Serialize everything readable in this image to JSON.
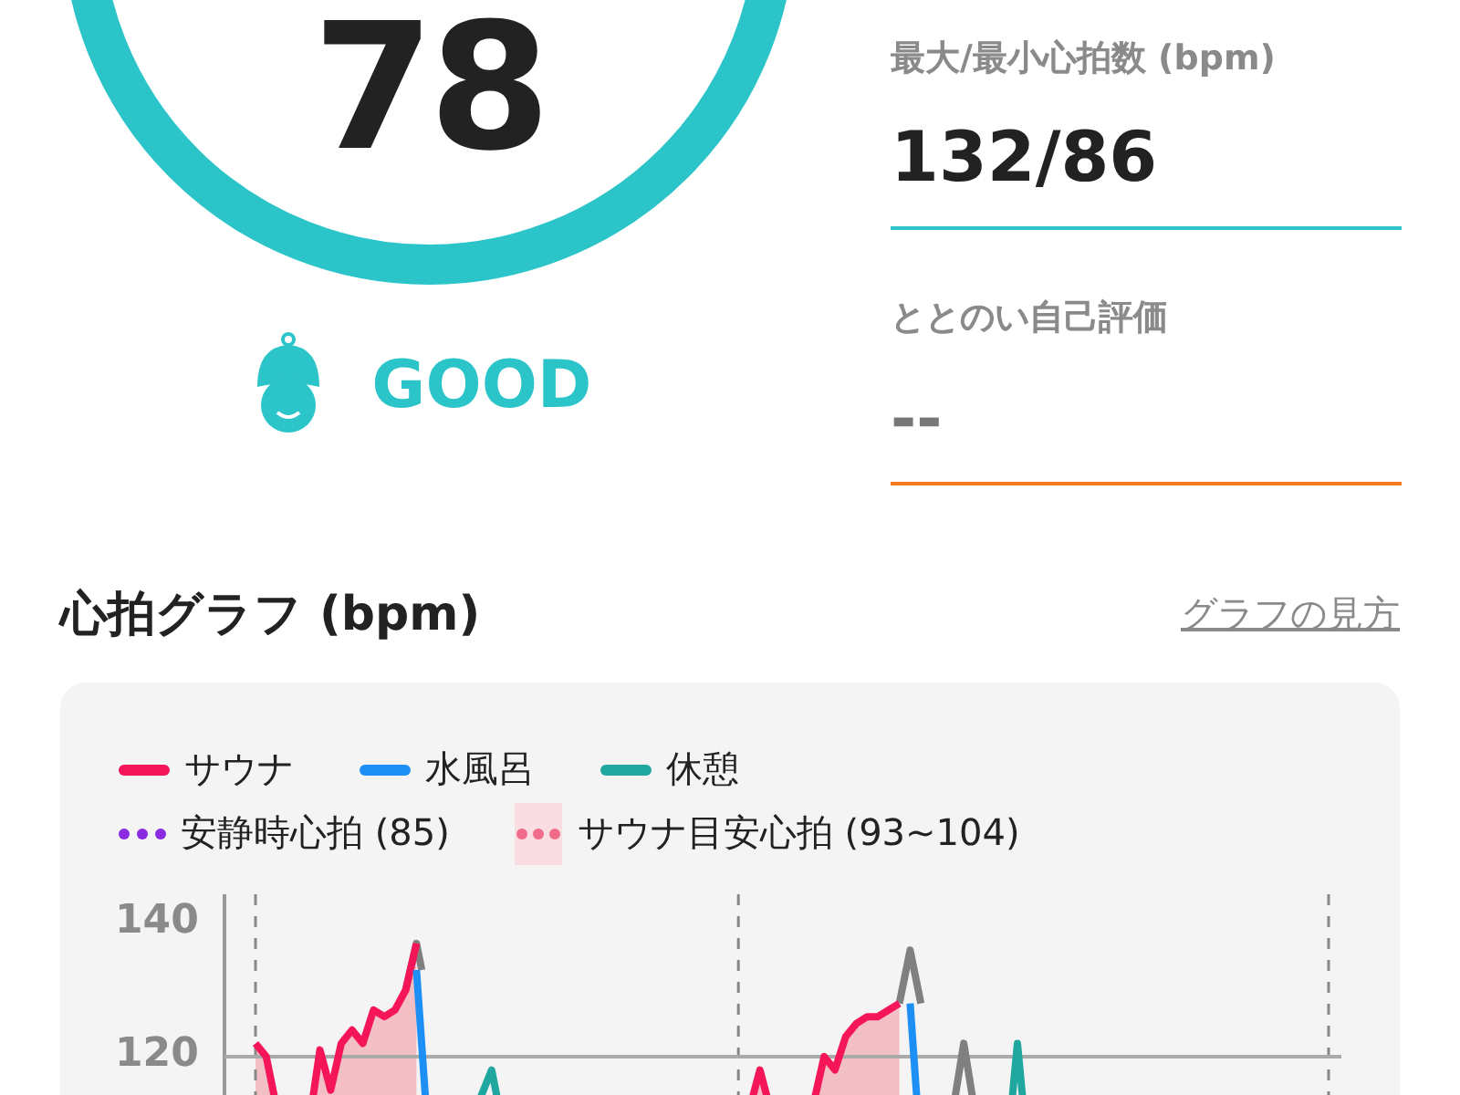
{
  "score": {
    "value": "78",
    "rating": "GOOD"
  },
  "stats": [
    {
      "label": "最大/最小心拍数 (bpm)",
      "value": "132/86",
      "filled": true,
      "color": "#2bc4c8"
    },
    {
      "label": "ととのい自己評価",
      "value": "--",
      "filled": false,
      "color": "#f47a20"
    }
  ],
  "graph": {
    "title": "心拍グラフ (bpm)",
    "help_link": "グラフの見方",
    "legend": [
      {
        "label": "サウナ",
        "kind": "line",
        "color": "#f5165a"
      },
      {
        "label": "水風呂",
        "kind": "line",
        "color": "#1e8ff5"
      },
      {
        "label": "休憩",
        "kind": "line",
        "color": "#20a8a0"
      },
      {
        "label": "安静時心拍 (85)",
        "kind": "dots",
        "color": "#8a2be2"
      },
      {
        "label": "サウナ目安心拍 (93~104)",
        "kind": "band",
        "color": "#f06a8a"
      }
    ],
    "y_axis_labels": [
      "140",
      "120"
    ]
  }
}
